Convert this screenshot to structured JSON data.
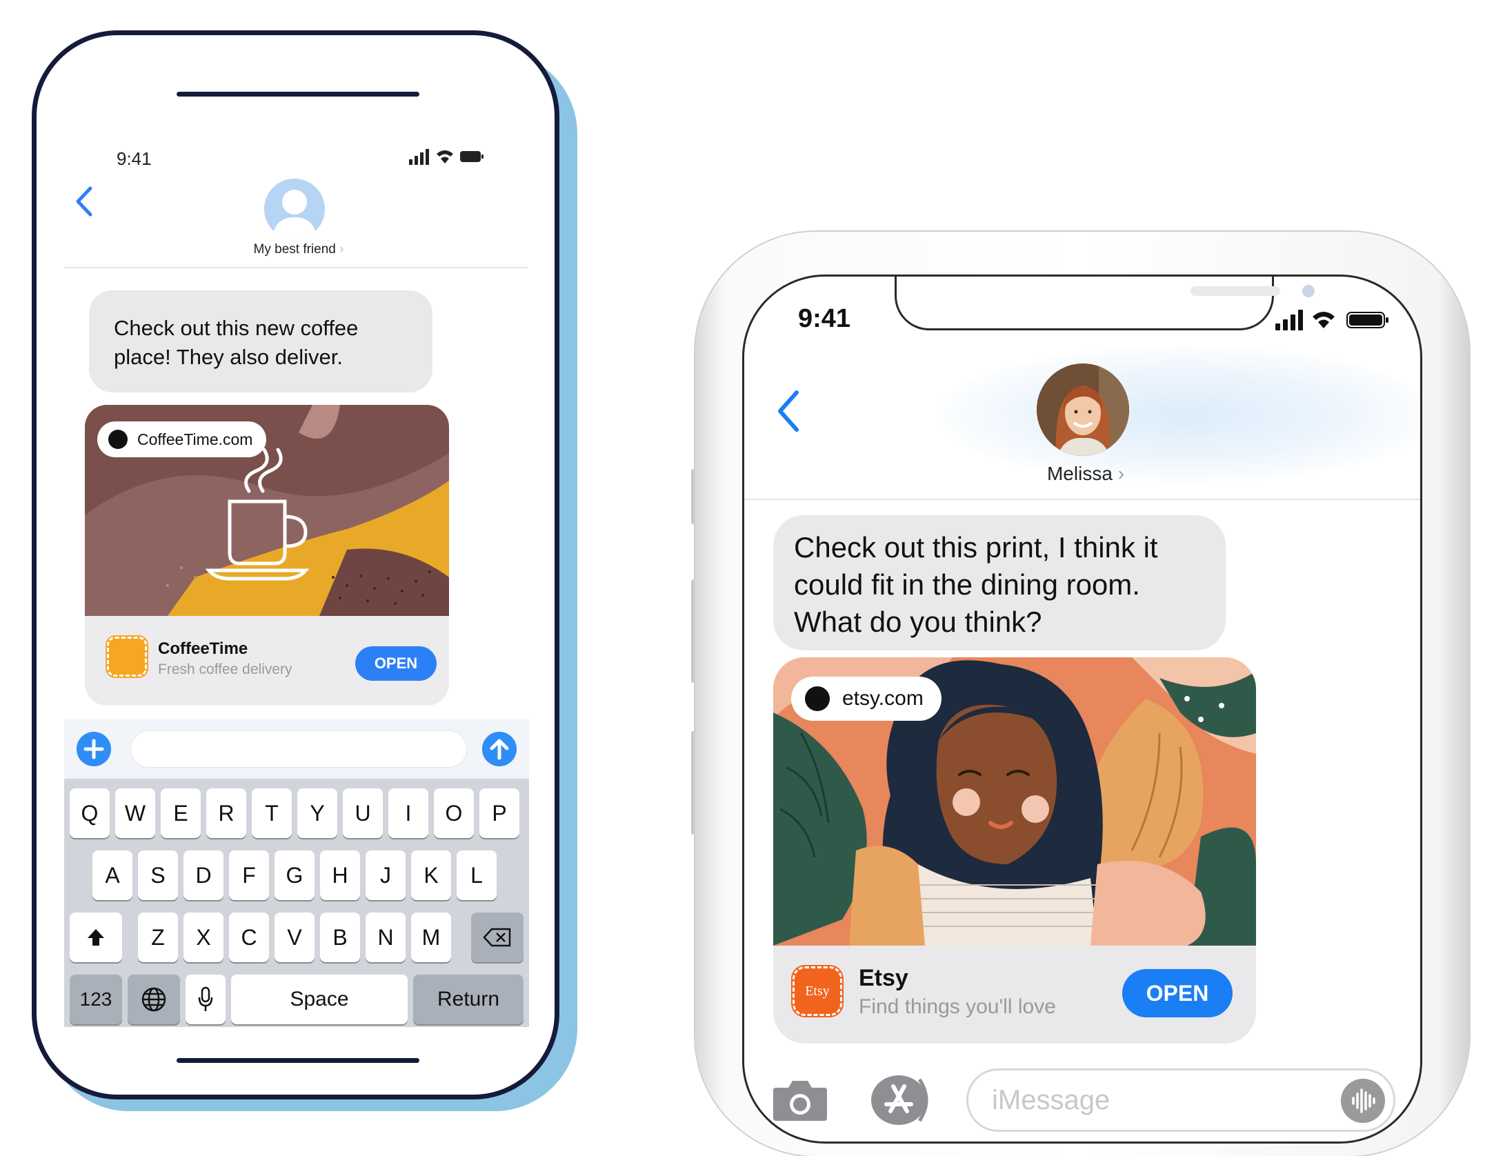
{
  "left_phone": {
    "status_time": "9:41",
    "contact_name": "My best friend",
    "message": "Check out this new coffee place! They also deliver.",
    "link_domain": "CoffeeTime.com",
    "app_name": "CoffeeTime",
    "app_subtitle": "Fresh coffee delivery",
    "open_label": "OPEN",
    "keyboard": {
      "row1": [
        "Q",
        "W",
        "E",
        "R",
        "T",
        "Y",
        "U",
        "I",
        "O",
        "P"
      ],
      "row2": [
        "A",
        "S",
        "D",
        "F",
        "G",
        "H",
        "J",
        "K",
        "L"
      ],
      "row3": [
        "Z",
        "X",
        "C",
        "V",
        "B",
        "N",
        "M"
      ],
      "numbers_key": "123",
      "space_key": "Space",
      "return_key": "Return"
    },
    "accent_color": "#2d7ff6"
  },
  "right_phone": {
    "status_time": "9:41",
    "contact_name": "Melissa",
    "message": "Check out this print, I think it could fit in the dining room. What do you think?",
    "link_domain": "etsy.com",
    "app_name": "Etsy",
    "app_icon_text": "Etsy",
    "app_subtitle": "Find things you'll love",
    "open_label": "OPEN",
    "input_placeholder": "iMessage",
    "brand_color": "#f1641e",
    "accent_color": "#1a7ef5"
  }
}
